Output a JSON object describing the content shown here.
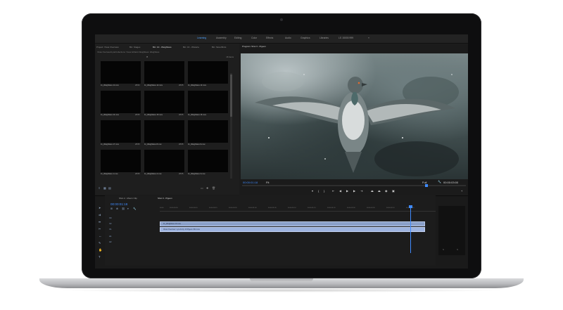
{
  "workspaces": {
    "items": [
      "Learning",
      "Assembly",
      "Editing",
      "Color",
      "Effects",
      "Audio",
      "Graphics",
      "Libraries",
      "LS 15000:999"
    ],
    "active": "Learning",
    "more_label": "»"
  },
  "project_panel": {
    "tabs": [
      "Project: Vivas Overview",
      "Bin: Stages",
      "Bin: 10 - Weightless",
      "Bin: 16 - Wisteria",
      "Bin: Slow-Birds"
    ],
    "active_tab": "Bin: 10 - Weightless",
    "path": "Vivas Overview/Lyra/Collections: Vivas Artifacts Weightless: Weightless",
    "item_count": "16 Items",
    "clips": [
      {
        "name": "11_Weightless 11.mov",
        "duration": "28:04"
      },
      {
        "name": "11_Weightless 12.mov",
        "duration": "28:05"
      },
      {
        "name": "11_Weightless 13.mov",
        "duration": ""
      },
      {
        "name": "11_Weightless 14.mov",
        "duration": "28:05"
      },
      {
        "name": "11_Weightless 15.mov",
        "duration": "28:05"
      },
      {
        "name": "11_Weightless 16.mov",
        "duration": ""
      },
      {
        "name": "11_Weightless 17.mov",
        "duration": "28:05"
      },
      {
        "name": "11_Weightless 8.mov",
        "duration": "28:05"
      },
      {
        "name": "11_Weightless 9.mov",
        "duration": ""
      },
      {
        "name": "11_Weightless 1.mov",
        "duration": "28:05"
      },
      {
        "name": "11_Weightless 2.mov",
        "duration": "28:05"
      },
      {
        "name": "11_Weightless 3.mov",
        "duration": ""
      }
    ]
  },
  "program_monitor": {
    "tab": "Program: Shot 3 - Pigeon",
    "current_time": "00:00:01:18",
    "fit": "Fit",
    "quality": "Full",
    "duration": "00:00:03:00"
  },
  "timeline": {
    "tabs": [
      "Shot 2 - Mourn Clip",
      "Shot 3 - Pigeon"
    ],
    "active_tab": "Shot 3 - Pigeon",
    "timecode": "00:00:01:18",
    "ruler": [
      "00:00",
      "00:00:00:05",
      "00:00:00:10",
      "00:00:00:15",
      "00:00:00:20",
      "00:00:01:00",
      "00:00:01:05",
      "00:00:01:10",
      "00:00:01:15",
      "00:00:01:20",
      "00:00:02:00",
      "00:00:02:05",
      "00:00:02:10",
      "00:00:02:15"
    ],
    "tracks": [
      "V3",
      "V2",
      "V1",
      "A1",
      "A2"
    ],
    "clip_v1": "11_Weightless 16.mov",
    "clip_v2": "Vivas Overview: Lyra Forty 16 Pigeon 304.mov"
  },
  "colors": {
    "accent": "#3f8bff",
    "clip": "#8aa0c9"
  }
}
